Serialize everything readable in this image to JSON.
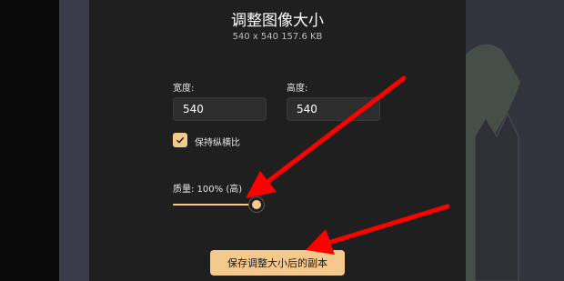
{
  "dialog": {
    "title": "调整图像大小",
    "subtitle": "540 x 540   157.6 KB",
    "width": {
      "label": "宽度:",
      "value": "540"
    },
    "height": {
      "label": "高度:",
      "value": "540"
    },
    "keep_aspect": {
      "label": "保持纵横比",
      "checked": true
    },
    "quality": {
      "label": "质量: 100% (高)",
      "value": 1.0
    },
    "save_button": "保存调整大小后的副本"
  },
  "colors": {
    "accent": "#f5c88c",
    "dialog_bg": "#1f1f1f",
    "annotation_arrow": "#ff0000"
  }
}
